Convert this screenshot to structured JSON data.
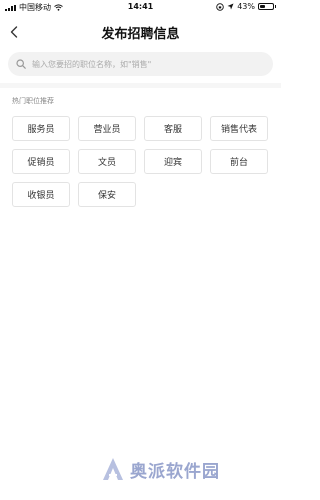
{
  "status_bar": {
    "carrier": "中国移动",
    "time": "14:41",
    "battery": "43%",
    "battery_level": 0.43
  },
  "nav": {
    "title": "发布招聘信息",
    "back_icon": "chevron-left-icon"
  },
  "search": {
    "placeholder": "输入您要招的职位名称，如\"销售\"",
    "value": "",
    "icon": "search-icon"
  },
  "hot_positions": {
    "title": "热门职位推荐",
    "items": [
      {
        "label": "服务员"
      },
      {
        "label": "营业员"
      },
      {
        "label": "客服"
      },
      {
        "label": "销售代表"
      },
      {
        "label": "促销员"
      },
      {
        "label": "文员"
      },
      {
        "label": "迎宾"
      },
      {
        "label": "前台"
      },
      {
        "label": "收银员"
      },
      {
        "label": "保安"
      }
    ]
  },
  "watermark": {
    "text": "奥派软件园"
  },
  "colors": {
    "accent": "#9aa6cf",
    "tag_border": "#e3e3e3",
    "search_bg": "#f2f2f2"
  }
}
